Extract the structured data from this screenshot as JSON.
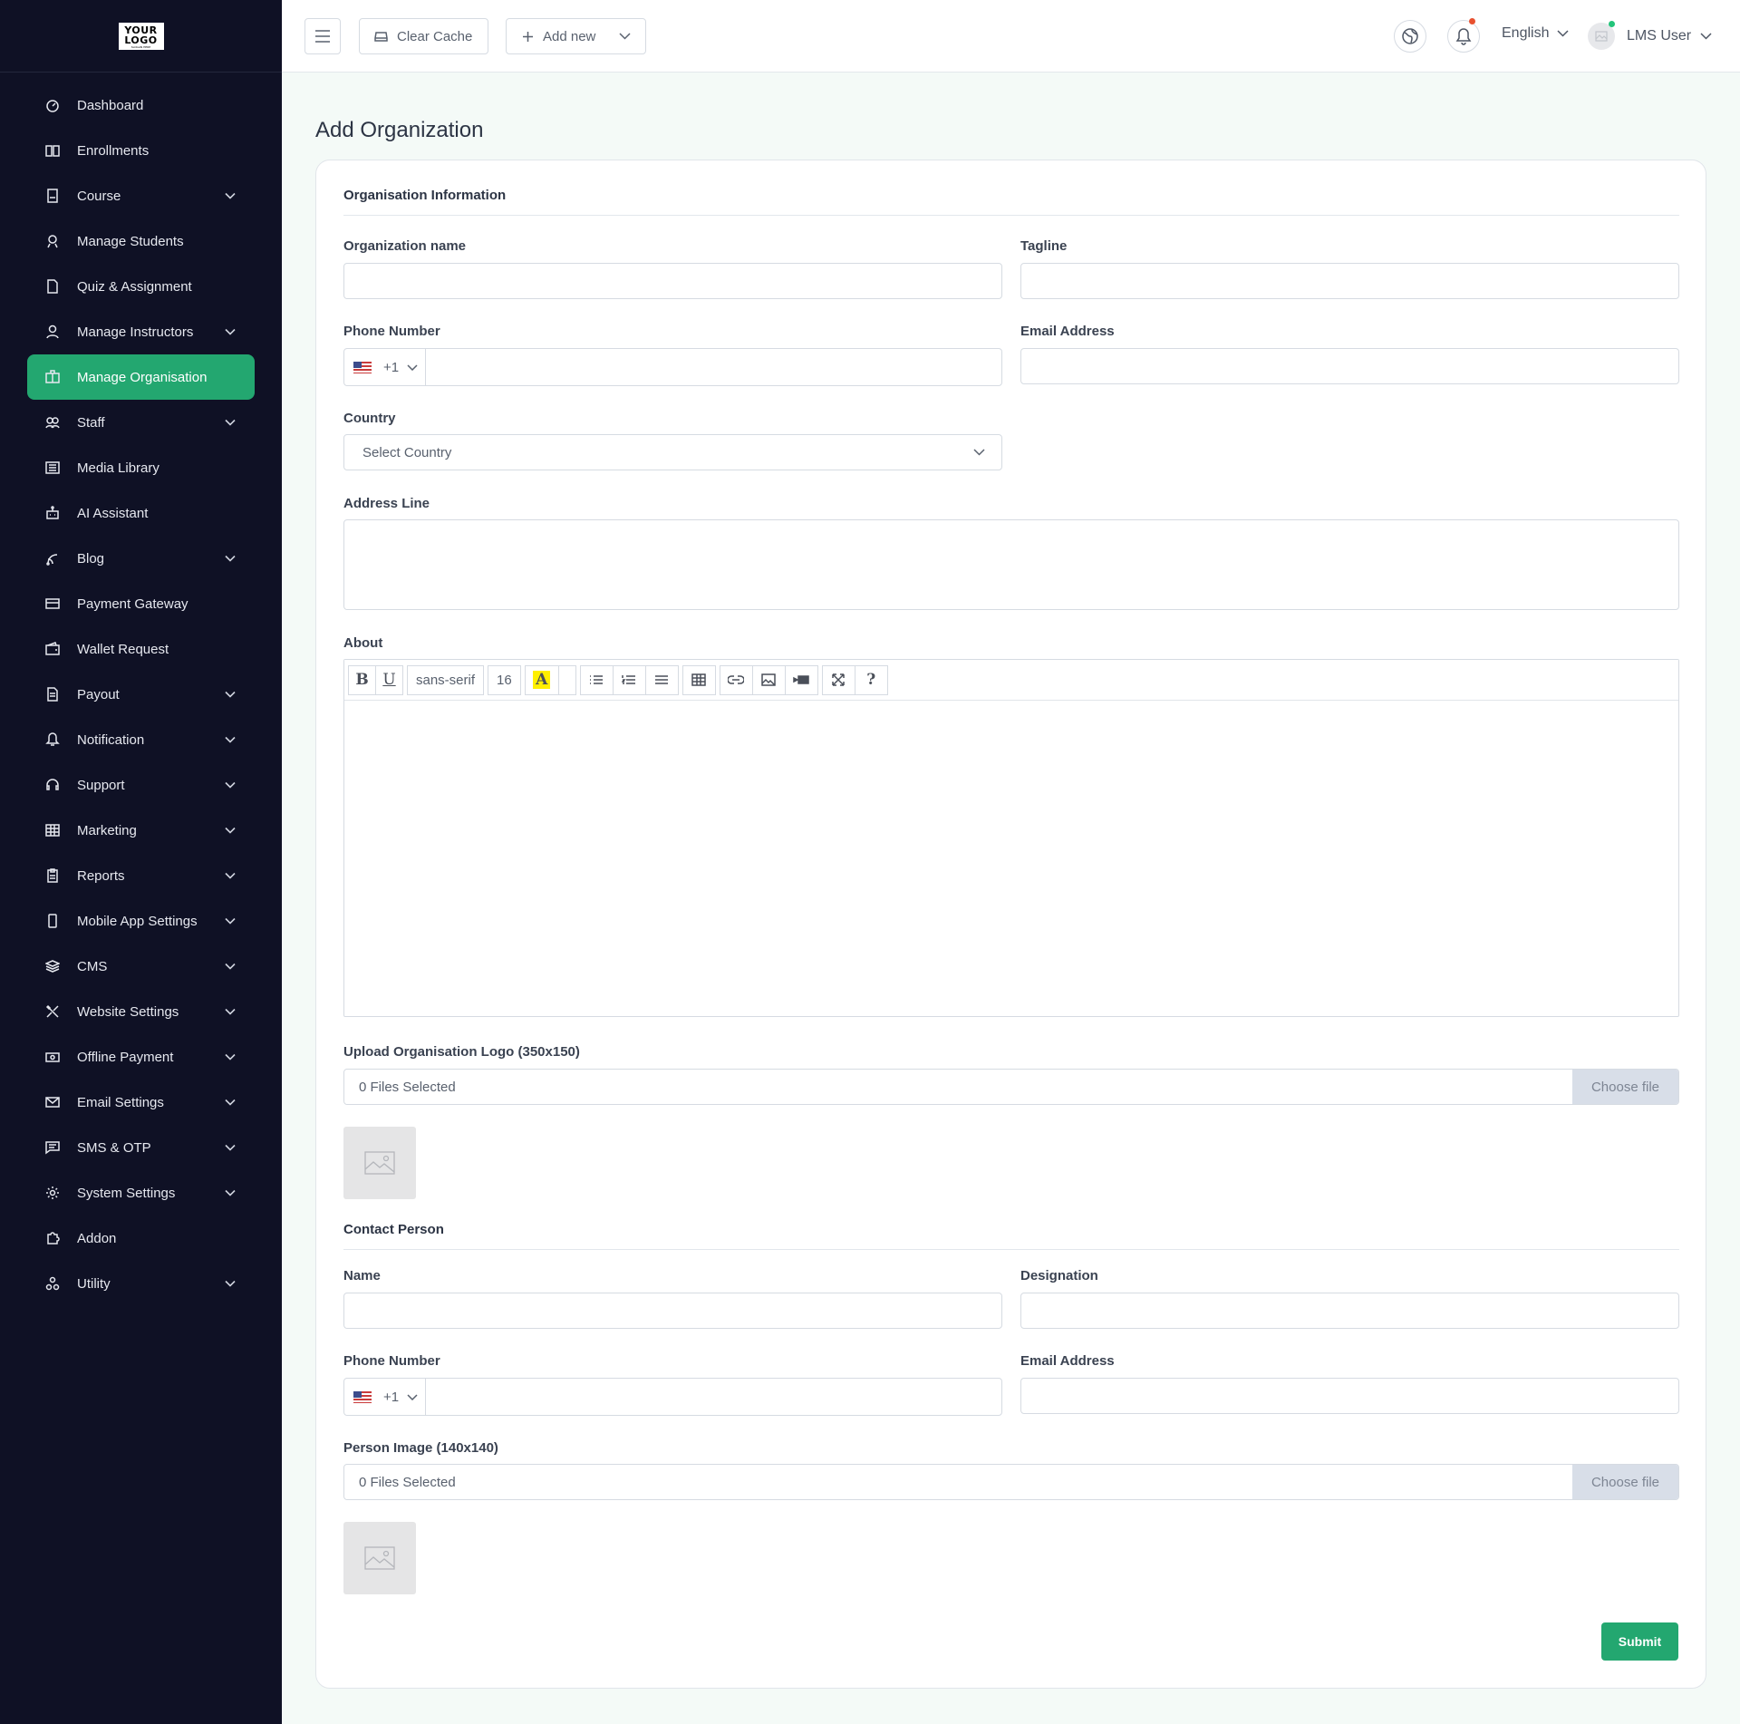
{
  "logo": {
    "line1": "YOUR",
    "line2": "LOGO",
    "tagline": "SLOGAN HERE"
  },
  "sidebar": {
    "items": [
      {
        "label": "Dashboard",
        "icon": "dashboard-icon",
        "has_chevron": false,
        "active": false
      },
      {
        "label": "Enrollments",
        "icon": "book-icon",
        "has_chevron": false,
        "active": false
      },
      {
        "label": "Course",
        "icon": "course-icon",
        "has_chevron": true,
        "active": false
      },
      {
        "label": "Manage Students",
        "icon": "student-icon",
        "has_chevron": false,
        "active": false
      },
      {
        "label": "Quiz & Assignment",
        "icon": "document-icon",
        "has_chevron": false,
        "active": false
      },
      {
        "label": "Manage Instructors",
        "icon": "user-icon",
        "has_chevron": true,
        "active": false
      },
      {
        "label": "Manage Organisation",
        "icon": "organisation-icon",
        "has_chevron": false,
        "active": true
      },
      {
        "label": "Staff",
        "icon": "users-icon",
        "has_chevron": true,
        "active": false
      },
      {
        "label": "Media Library",
        "icon": "media-icon",
        "has_chevron": false,
        "active": false
      },
      {
        "label": "AI Assistant",
        "icon": "robot-icon",
        "has_chevron": false,
        "active": false
      },
      {
        "label": "Blog",
        "icon": "blog-icon",
        "has_chevron": true,
        "active": false
      },
      {
        "label": "Payment Gateway",
        "icon": "card-icon",
        "has_chevron": false,
        "active": false
      },
      {
        "label": "Wallet Request",
        "icon": "wallet-icon",
        "has_chevron": false,
        "active": false
      },
      {
        "label": "Payout",
        "icon": "payout-icon",
        "has_chevron": true,
        "active": false
      },
      {
        "label": "Notification",
        "icon": "bell-icon",
        "has_chevron": true,
        "active": false
      },
      {
        "label": "Support",
        "icon": "headset-icon",
        "has_chevron": true,
        "active": false
      },
      {
        "label": "Marketing",
        "icon": "grid-icon",
        "has_chevron": true,
        "active": false
      },
      {
        "label": "Reports",
        "icon": "report-icon",
        "has_chevron": true,
        "active": false
      },
      {
        "label": "Mobile App Settings",
        "icon": "mobile-icon",
        "has_chevron": true,
        "active": false
      },
      {
        "label": "CMS",
        "icon": "layers-icon",
        "has_chevron": true,
        "active": false
      },
      {
        "label": "Website Settings",
        "icon": "tools-icon",
        "has_chevron": true,
        "active": false
      },
      {
        "label": "Offline Payment",
        "icon": "cash-icon",
        "has_chevron": true,
        "active": false
      },
      {
        "label": "Email Settings",
        "icon": "mail-icon",
        "has_chevron": true,
        "active": false
      },
      {
        "label": "SMS & OTP",
        "icon": "message-icon",
        "has_chevron": true,
        "active": false
      },
      {
        "label": "System Settings",
        "icon": "gear-icon",
        "has_chevron": true,
        "active": false
      },
      {
        "label": "Addon",
        "icon": "puzzle-icon",
        "has_chevron": false,
        "active": false
      },
      {
        "label": "Utility",
        "icon": "utility-icon",
        "has_chevron": true,
        "active": false
      }
    ]
  },
  "topbar": {
    "clear_cache": "Clear Cache",
    "add_new": "Add new",
    "language": "English",
    "user_name": "LMS User"
  },
  "page": {
    "title": "Add Organization"
  },
  "org_section": {
    "heading": "Organisation Information",
    "org_name_label": "Organization name",
    "org_name_value": "",
    "tagline_label": "Tagline",
    "tagline_value": "",
    "phone_label": "Phone Number",
    "phone_code": "+1",
    "phone_value": "",
    "email_label": "Email Address",
    "email_value": "",
    "country_label": "Country",
    "country_value": "Select Country",
    "address_label": "Address Line",
    "address_value": "",
    "about_label": "About",
    "editor": {
      "bold": "B",
      "underline": "U",
      "font_family": "sans-serif",
      "font_size": "16",
      "color_letter": "A",
      "help": "?"
    },
    "logo_label": "Upload Organisation Logo (350x150)",
    "logo_files": "0 Files Selected",
    "logo_choose": "Choose file"
  },
  "contact_section": {
    "heading": "Contact Person",
    "name_label": "Name",
    "name_value": "",
    "designation_label": "Designation",
    "designation_value": "",
    "phone_label": "Phone Number",
    "phone_code": "+1",
    "phone_value": "",
    "email_label": "Email Address",
    "email_value": "",
    "image_label": "Person Image (140x140)",
    "image_files": "0 Files Selected",
    "image_choose": "Choose file"
  },
  "submit_label": "Submit",
  "colors": {
    "sidebar_bg": "#0f1125",
    "accent": "#23a770",
    "page_bg": "#f4faf7",
    "notification_dot": "#e8512f",
    "online_dot": "#23c47a"
  }
}
